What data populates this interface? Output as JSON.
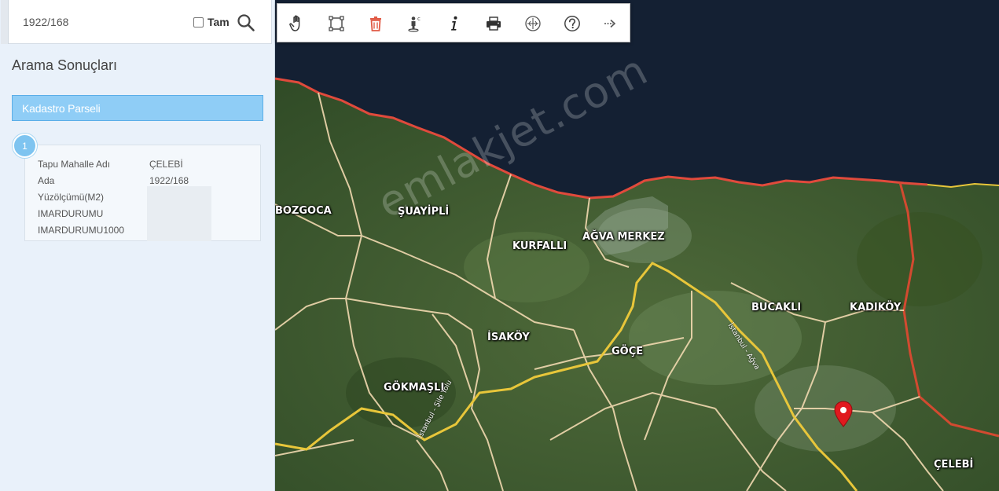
{
  "search": {
    "value": "1922/168",
    "tam_label": "Tam"
  },
  "results": {
    "title": "Arama Sonuçları",
    "category": "Kadastro Parseli",
    "items": [
      {
        "number": "1",
        "attributes": [
          {
            "label": "Tapu Mahalle Adı",
            "value": "ÇELEBİ"
          },
          {
            "label": "Ada",
            "value": "1922/168"
          },
          {
            "label": "Yüzölçümü(M2)",
            "value": ""
          },
          {
            "label": "IMARDURUMU",
            "value": ""
          },
          {
            "label": "IMARDURUMU1000",
            "value": ""
          }
        ]
      }
    ]
  },
  "toolbar": {
    "tools": [
      "pan-hand-icon",
      "select-rectangle-icon",
      "delete-trash-icon",
      "street-view-icon",
      "info-icon",
      "print-icon",
      "measure-icon",
      "help-icon",
      "next-arrow-icon"
    ]
  },
  "map": {
    "places": {
      "bozgoca": "BOZGOCA",
      "suayipli": "ŞUAYİPLİ",
      "kurfalli": "KURFALLI",
      "agva": "AĞVA MERKEZ",
      "bucakli": "BUCAKLI",
      "kadikoy": "KADIKÖY",
      "isakoy": "İSAKÖY",
      "goce": "GÖÇE",
      "gokmasli": "GÖKMAŞLI",
      "celebi": "ÇELEBİ"
    },
    "roads": {
      "sile_road": "İstanbul - Şile Yolu",
      "istanbul_road": "İstanbul - Ağva"
    },
    "watermark": "emlakjet.com",
    "colors": {
      "sea": "#142033",
      "land": "#3d5a2e",
      "boundary": "#e04a3c",
      "road_main": "#e8c63a",
      "road_minor": "#f1d9b0",
      "pin": "#e0191e"
    }
  }
}
